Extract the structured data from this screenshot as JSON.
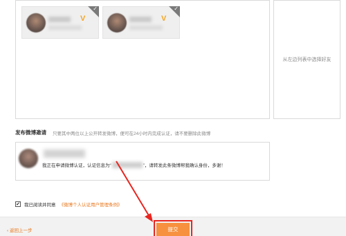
{
  "friend_cards": [
    {
      "verified_badge": "V"
    },
    {
      "verified_badge": "V"
    }
  ],
  "hint": {
    "text": "从左边列表中选择好友"
  },
  "invite": {
    "title": "发布微博邀请",
    "description": "只要其中两位以上公开转发微博，便可在24小时内完成认证，请不要删除此微博",
    "message_prefix": "我正在申请微博认证，认证信息为“",
    "message_suffix": "”，请转发此条微博帮我确认身份，多谢！"
  },
  "agreement": {
    "label": "我已阅读并同意",
    "terms_link": "《微博个人认证用户管理条例》",
    "checked_mark": "✔"
  },
  "footer": {
    "back_link": "‹ 返回上一步",
    "submit_label": "提交"
  },
  "colors": {
    "accent": "#f7913f",
    "link": "#e8761b",
    "highlight": "#e8251f",
    "verified": "#f5a623"
  }
}
